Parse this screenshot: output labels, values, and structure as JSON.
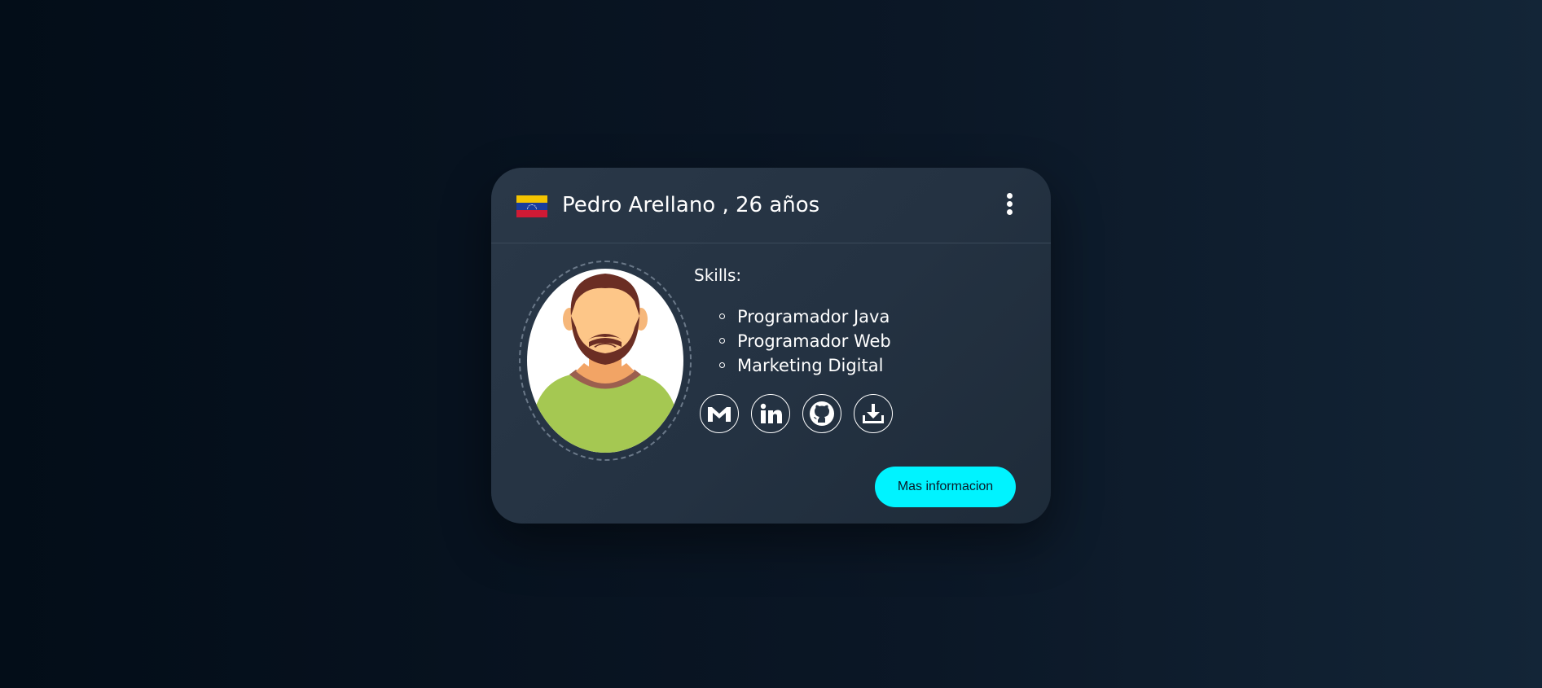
{
  "profile": {
    "name_line": "Pedro Arellano , 26 años",
    "flag_icon": "venezuela-flag-icon",
    "menu_icon": "kebab-menu-icon",
    "avatar_icon": "bearded-man-avatar-icon"
  },
  "skills": {
    "title": "Skills:",
    "items": [
      {
        "label": "Programador Java"
      },
      {
        "label": "Programador Web"
      },
      {
        "label": "Marketing Digital"
      }
    ]
  },
  "social": [
    {
      "icon": "gmail-icon"
    },
    {
      "icon": "linkedin-icon"
    },
    {
      "icon": "github-icon"
    },
    {
      "icon": "download-icon"
    }
  ],
  "actions": {
    "more_info_label": "Mas informacion"
  },
  "colors": {
    "accent": "#00f3ff",
    "card": "#263444",
    "background": "#07111e"
  }
}
